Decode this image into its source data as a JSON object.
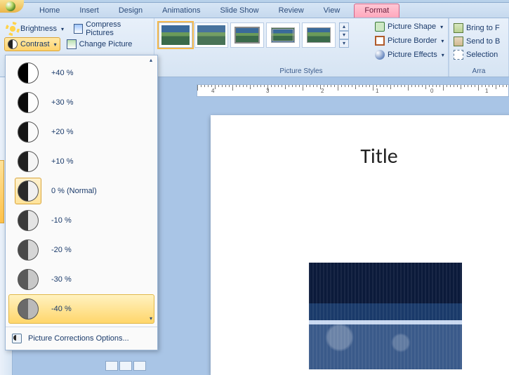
{
  "tabs": {
    "home": "Home",
    "insert": "Insert",
    "design": "Design",
    "animations": "Animations",
    "slideshow": "Slide Show",
    "review": "Review",
    "view": "View",
    "format": "Format"
  },
  "ribbon": {
    "adjust": {
      "brightness": "Brightness",
      "contrast": "Contrast",
      "compress": "Compress Pictures",
      "change": "Change Picture"
    },
    "picture_styles": {
      "label": "Picture Styles",
      "shape": "Picture Shape",
      "border": "Picture Border",
      "effects": "Picture Effects"
    },
    "arrange": {
      "label": "Arra",
      "bringfront": "Bring to F",
      "sendback": "Send to B",
      "selection": "Selection"
    }
  },
  "contrast_menu": {
    "items": [
      {
        "key": "c40",
        "label": "+40 %"
      },
      {
        "key": "c30",
        "label": "+30 %"
      },
      {
        "key": "c20",
        "label": "+20 %"
      },
      {
        "key": "c10",
        "label": "+10 %"
      },
      {
        "key": "c0",
        "label": "0 % (Normal)"
      },
      {
        "key": "cm10",
        "label": "-10 %"
      },
      {
        "key": "cm20",
        "label": "-20 %"
      },
      {
        "key": "cm30",
        "label": "-30 %"
      },
      {
        "key": "cm40",
        "label": "-40 %"
      }
    ],
    "selected_index": 4,
    "hover_index": 8,
    "footer": "Picture Corrections Options..."
  },
  "slide": {
    "title": "Title"
  },
  "ruler": {
    "labels": [
      "4",
      "3",
      "2",
      "1",
      "0",
      "1"
    ]
  }
}
